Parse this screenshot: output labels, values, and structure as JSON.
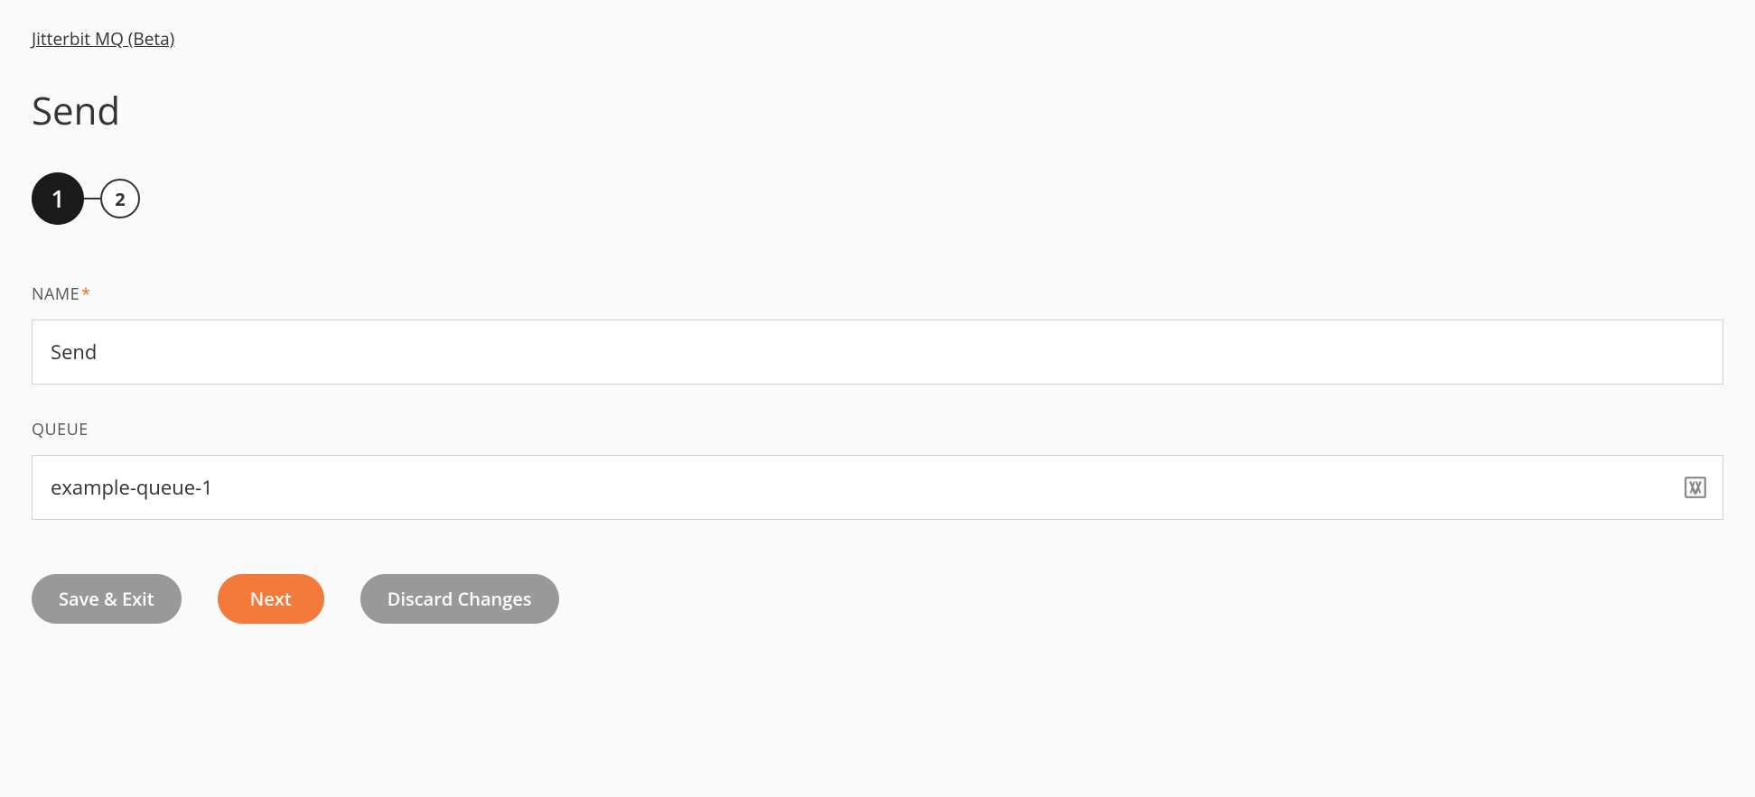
{
  "breadcrumb": {
    "label": "Jitterbit MQ (Beta)"
  },
  "title": "Send",
  "stepper": {
    "steps": [
      "1",
      "2"
    ],
    "activeIndex": 0
  },
  "form": {
    "name": {
      "label": "NAME",
      "required": true,
      "value": "Send"
    },
    "queue": {
      "label": "QUEUE",
      "required": false,
      "value": "example-queue-1"
    }
  },
  "buttons": {
    "saveExit": "Save & Exit",
    "next": "Next",
    "discard": "Discard Changes"
  }
}
